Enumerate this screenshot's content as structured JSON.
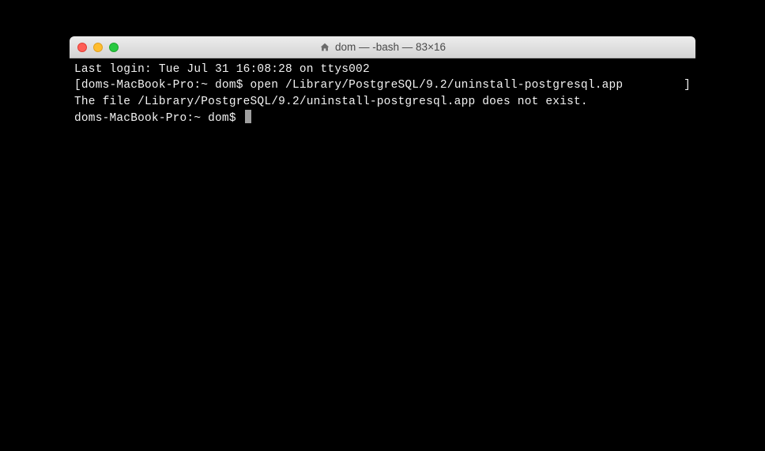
{
  "window": {
    "title": "dom — -bash — 83×16"
  },
  "terminal": {
    "last_login": "Last login: Tue Jul 31 16:08:28 on ttys002",
    "bracket_open": "[",
    "bracket_close": "]",
    "prompt1": "doms-MacBook-Pro:~ dom$ ",
    "command1": "open /Library/PostgreSQL/9.2/uninstall-postgresql.app",
    "output1": "The file /Library/PostgreSQL/9.2/uninstall-postgresql.app does not exist.",
    "prompt2": "doms-MacBook-Pro:~ dom$ "
  }
}
